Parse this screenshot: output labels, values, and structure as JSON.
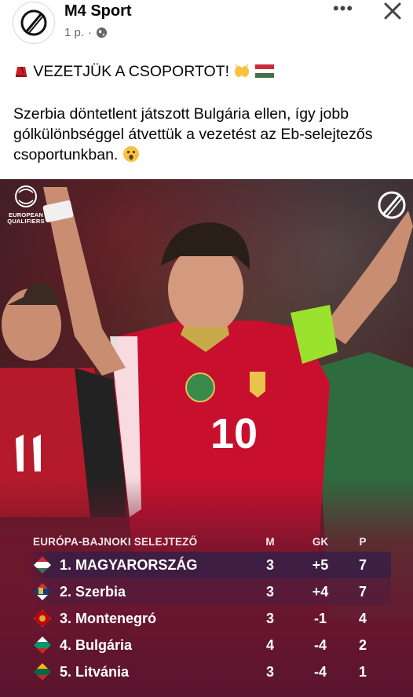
{
  "post": {
    "page_name": "M4 Sport",
    "time": "1 p.",
    "separator": "·",
    "more_label": "•••",
    "headline": "VEZETJÜK A CSOPORTOT!",
    "body": "Szerbia döntetlent játszott Bulgária ellen, így jobb gólkülönbséggel átvettük a vezetést az Eb-selejtezős csoportunkban."
  },
  "image": {
    "logo_text_line1": "EUROPEAN",
    "logo_text_line2": "QUALIFIERS",
    "table": {
      "title": "EURÓPA-BAJNOKI SELEJTEZŐ",
      "col_m": "M",
      "col_gk": "GK",
      "col_p": "P",
      "rows": [
        {
          "team": "1. MAGYARORSZÁG",
          "m": "3",
          "gk": "+5",
          "p": "7",
          "flag": "hungary"
        },
        {
          "team": "2. Szerbia",
          "m": "3",
          "gk": "+4",
          "p": "7",
          "flag": "serbia"
        },
        {
          "team": "3. Montenegró",
          "m": "3",
          "gk": "-1",
          "p": "4",
          "flag": "montenegro"
        },
        {
          "team": "4. Bulgária",
          "m": "4",
          "gk": "-4",
          "p": "2",
          "flag": "bulgaria"
        },
        {
          "team": "5. Litvánia",
          "m": "3",
          "gk": "-4",
          "p": "1",
          "flag": "lithuania"
        }
      ]
    }
  },
  "colors": {
    "hungary_red": "#cd2a3e",
    "hungary_green": "#436f4d",
    "jersey_red": "#c8102e"
  }
}
